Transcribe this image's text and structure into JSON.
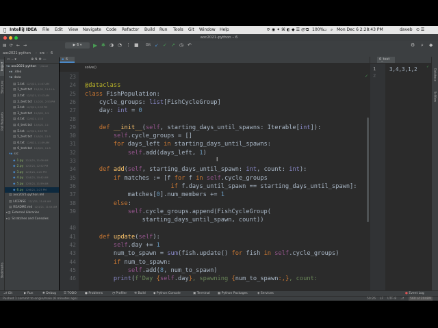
{
  "menubar": {
    "app": "IntelliJ IDEA",
    "items": [
      "File",
      "Edit",
      "View",
      "Navigate",
      "Code",
      "Refactor",
      "Build",
      "Run",
      "Tools",
      "Git",
      "Window",
      "Help"
    ],
    "battery": "100%",
    "datetime": "Mon Dec 6  2:28:43 PM",
    "user": "daveb"
  },
  "window": {
    "title": "aoc2021-python – 6"
  },
  "navbar": {
    "project": "aoc2021-python",
    "folder": "src",
    "file": "6"
  },
  "project_tree": {
    "root_label": "aoc2021-python",
    "root_path": "~/devel",
    "idea": ".idea",
    "data": "data",
    "data_files": [
      {
        "name": "1.txt",
        "date": "12/1/21, 11:07 AM"
      },
      {
        "name": "1_test.txt",
        "date": "12/1/21, 11:11 A"
      },
      {
        "name": "2.txt",
        "date": "12/2/21, 11:13 AM"
      },
      {
        "name": "2_test.txt",
        "date": "12/2/21, 2:53 PM"
      },
      {
        "name": "3.txt",
        "date": "12/3/21, 2:39 PM"
      },
      {
        "name": "3_test.txt",
        "date": "12/3/21, 2:5"
      },
      {
        "name": "4.txt",
        "date": "12/4/21, 11:3"
      },
      {
        "name": "4_test.txt",
        "date": "12/4/21, 11:"
      },
      {
        "name": "5.txt",
        "date": "12/5/21, 3:49 PM"
      },
      {
        "name": "5_test.txt",
        "date": "12/5/21, 11:5"
      },
      {
        "name": "6.txt",
        "date": "12/6/21, 11:59 AM"
      },
      {
        "name": "6_test.txt",
        "date": "12/6/21, 11:5"
      }
    ],
    "src": "src",
    "src_files": [
      {
        "name": "1.py",
        "date": "12/1/21, 11:08 AM"
      },
      {
        "name": "2.py",
        "date": "12/2/21, 12:52 PM"
      },
      {
        "name": "3.py",
        "date": "12/3/21, 2:20 PM"
      },
      {
        "name": "4.py",
        "date": "12/4/21, 10:42 AM"
      },
      {
        "name": "5.py",
        "date": "12/5/21, 11:59 AM"
      },
      {
        "name": "6.py",
        "date": "12/6/21, 2:27 PM"
      }
    ],
    "iml": "aoc2021-python.iml",
    "license": "LICENSE",
    "license_date": "12/1/21, 11:04 AM",
    "readme": "README.md",
    "readme_date": "12/1/21, 11:04 AM",
    "external": "External Libraries",
    "scratches": "Scratches and Consoles"
  },
  "left_strip_labels": [
    "Project",
    "Structure",
    "Pull Requests",
    "Bookmarks"
  ],
  "right_strip_labels": [
    "Database",
    "SciView"
  ],
  "editor": {
    "tab": "6",
    "breadcrumb": "solve()",
    "lines": [
      {
        "n": "23",
        "html": ""
      },
      {
        "n": "24",
        "html": "<span class='dec'>@dataclass</span>"
      },
      {
        "n": "25",
        "html": "<span class='kw'>class</span> FishPopulation:"
      },
      {
        "n": "26",
        "html": "    cycle_groups: <span class='tp'>list</span>[FishCycleGroup]"
      },
      {
        "n": "27",
        "html": "    day: <span class='tp'>int</span> = <span class='num'>0</span>"
      },
      {
        "n": "28",
        "html": ""
      },
      {
        "n": "29",
        "html": "    <span class='kw'>def</span> <span class='fn'>__init__</span>(<span class='slf'>self</span>, starting_days_until_spawns: Iterable[<span class='tp'>int</span>]):"
      },
      {
        "n": "30",
        "html": "        <span class='slf'>self</span>.cycle_groups = []"
      },
      {
        "n": "31",
        "html": "        <span class='kw'>for</span> days_left <span class='kw'>in</span> starting_days_until_spawns:"
      },
      {
        "n": "32",
        "html": "            <span class='slf'>self</span>.add(days_left, <span class='num'>1</span>)"
      },
      {
        "n": "33",
        "html": ""
      },
      {
        "n": "34",
        "html": "    <span class='kw'>def</span> <span class='fn'>add</span>(<span class='slf'>self</span>, starting_days_until_spawn: <span class='tp'>int</span>, count: <span class='tp'>int</span>):"
      },
      {
        "n": "35",
        "html": "        <span class='kw'>if</span> matches := [f <span class='kw'>for</span> f <span class='kw'>in</span> <span class='slf'>self</span>.cycle_groups"
      },
      {
        "n": "36",
        "html": "                        <span class='kw'>if</span> f.days_until_spawn == starting_days_until_spawn]:"
      },
      {
        "n": "37",
        "html": "            matches[<span class='num'>0</span>].num_members += <span class='num'>1</span>"
      },
      {
        "n": "38",
        "html": "        <span class='kw'>else</span>:"
      },
      {
        "n": "39",
        "html": "            <span class='slf'>self</span>.cycle_groups.append(FishCycleGroup("
      },
      {
        "n": "",
        "html": "                starting_days_until_spawn, count))"
      },
      {
        "n": "40",
        "html": ""
      },
      {
        "n": "41",
        "html": "    <span class='kw'>def</span> <span class='fn'>update</span>(<span class='slf'>self</span>):"
      },
      {
        "n": "42",
        "html": "        <span class='slf'>self</span>.day += <span class='num'>1</span>"
      },
      {
        "n": "43",
        "html": "        num_to_spawn = <span class='tp'>sum</span>(fish.update() <span class='kw'>for</span> fish <span class='kw'>in</span> <span class='slf'>self</span>.cycle_groups)"
      },
      {
        "n": "44",
        "html": "        <span class='kw'>if</span> num_to_spawn:"
      },
      {
        "n": "45",
        "html": "            <span class='slf'>self</span>.add(<span class='num'>8</span>, num_to_spawn)"
      },
      {
        "n": "46",
        "html": "        <span class='tp'>print</span>(<span class='str'>f'Day </span><span class='ev'>{</span><span class='slf'>self</span>.day<span class='ev'>}</span><span class='str'>, spawning </span><span class='ev'>{</span>num_to_spawn<span class='ev'>:,}</span><span class='str'>, count:</span>"
      }
    ]
  },
  "right_pane": {
    "tab": "6_test",
    "line1": "1",
    "line2": "2",
    "content": "3,4,3,1,2"
  },
  "bottom_tools": [
    "Git",
    "Run",
    "Debug",
    "TODO",
    "Problems",
    "Profiler",
    "Build",
    "Python Console",
    "Terminal",
    "Python Packages",
    "Services"
  ],
  "event_log": "Event Log",
  "status": {
    "message": "Pushed 1 commit to origin/main (6 minutes ago)",
    "position": "50:26",
    "lf": "LF",
    "encoding": "UTF-8",
    "indent": "4 spaces",
    "branch": "main",
    "memory": "560 of 2048M"
  },
  "colors": {
    "accent": "#4a88c7",
    "run": "#499c54",
    "editor_bg": "#2b2b2b",
    "panel_bg": "#3c3f41"
  }
}
